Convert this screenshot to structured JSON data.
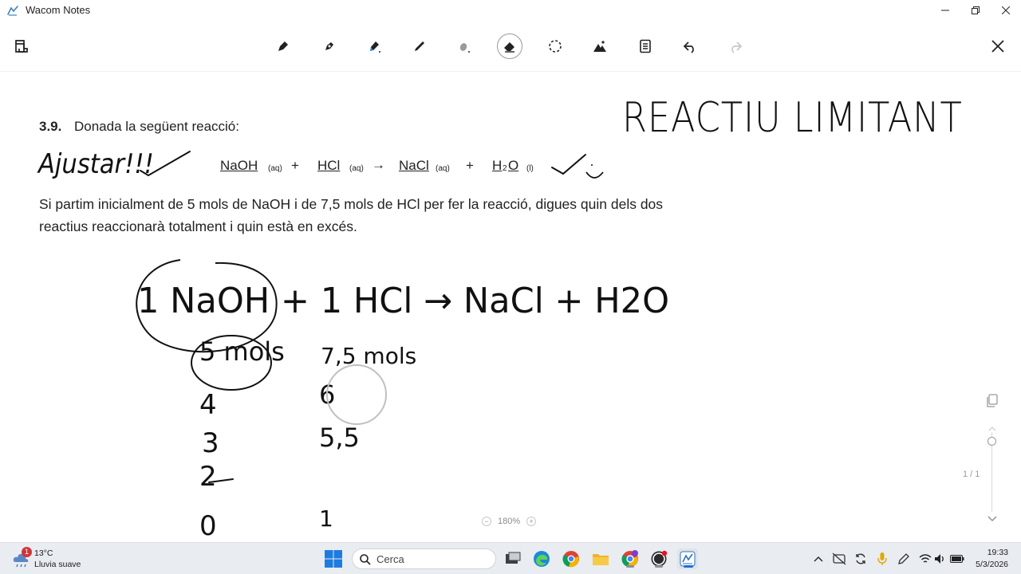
{
  "window": {
    "title": "Wacom Notes",
    "controls": [
      "minimize",
      "maximize",
      "close"
    ]
  },
  "toolbar": {
    "tools": [
      "fullscreen-icon",
      "pen-icon",
      "brush-icon",
      "highlighter-icon",
      "pencil-icon",
      "marker-icon",
      "eraser-icon",
      "lasso-icon",
      "insert-image-icon",
      "layout-icon",
      "undo-icon",
      "redo-icon",
      "close-icon"
    ],
    "selected_tool": "eraser-icon"
  },
  "document": {
    "exercise_number": "3.9.",
    "exercise_intro": "Donada la següent reacció:",
    "equation": {
      "r1": "NaOH",
      "r1_state": "(aq)",
      "plus1": "+",
      "r2": "HCl",
      "r2_state": "(aq)",
      "arrow": "→",
      "p1": "NaCl",
      "p1_state": "(aq)",
      "plus2": "+",
      "p2": "H",
      "p2_sub": "2",
      "p2_end": "O",
      "p2_state": "(l)"
    },
    "statement": "Si partim inicialment de 5 mols de NaOH i de 7,5 mols de HCl per fer la reacció, digues quin dels dos reactius reaccionarà totalment i quin està en excés."
  },
  "handwriting": {
    "title": "REACTIU LIMITANT",
    "note": "Ajustar!!!",
    "reaction": "1 NaOH + 1 HCl → NaCl + H2O",
    "naoh_col": [
      "5 mols",
      "4",
      "3",
      "2",
      "0"
    ],
    "hcl_col": [
      "7,5 mols",
      "6",
      "5,5",
      "1"
    ]
  },
  "zoom": {
    "level": "180%"
  },
  "page_indicator": "1 / 1",
  "taskbar": {
    "weather_badge": "1",
    "weather_temp": "13°C",
    "weather_desc": "Lluvia suave",
    "search_placeholder": "Cerca",
    "apps": [
      "task-view-icon",
      "edge-icon",
      "chrome-icon",
      "file-explorer-icon",
      "chrome-profile-icon",
      "obs-icon",
      "wacom-notes-icon"
    ],
    "tray": [
      "chevron-up-icon",
      "no-location-icon",
      "sync-icon",
      "microphone-icon",
      "pen-icon",
      "wifi-icon",
      "volume-icon",
      "battery-icon"
    ],
    "time": "19:33",
    "date": "5/3/2026"
  },
  "colors": {
    "ink": "#111111",
    "toolbar_bg": "#ffffff",
    "taskbar_bg": "#e9ecf1",
    "badge": "#d13438"
  }
}
